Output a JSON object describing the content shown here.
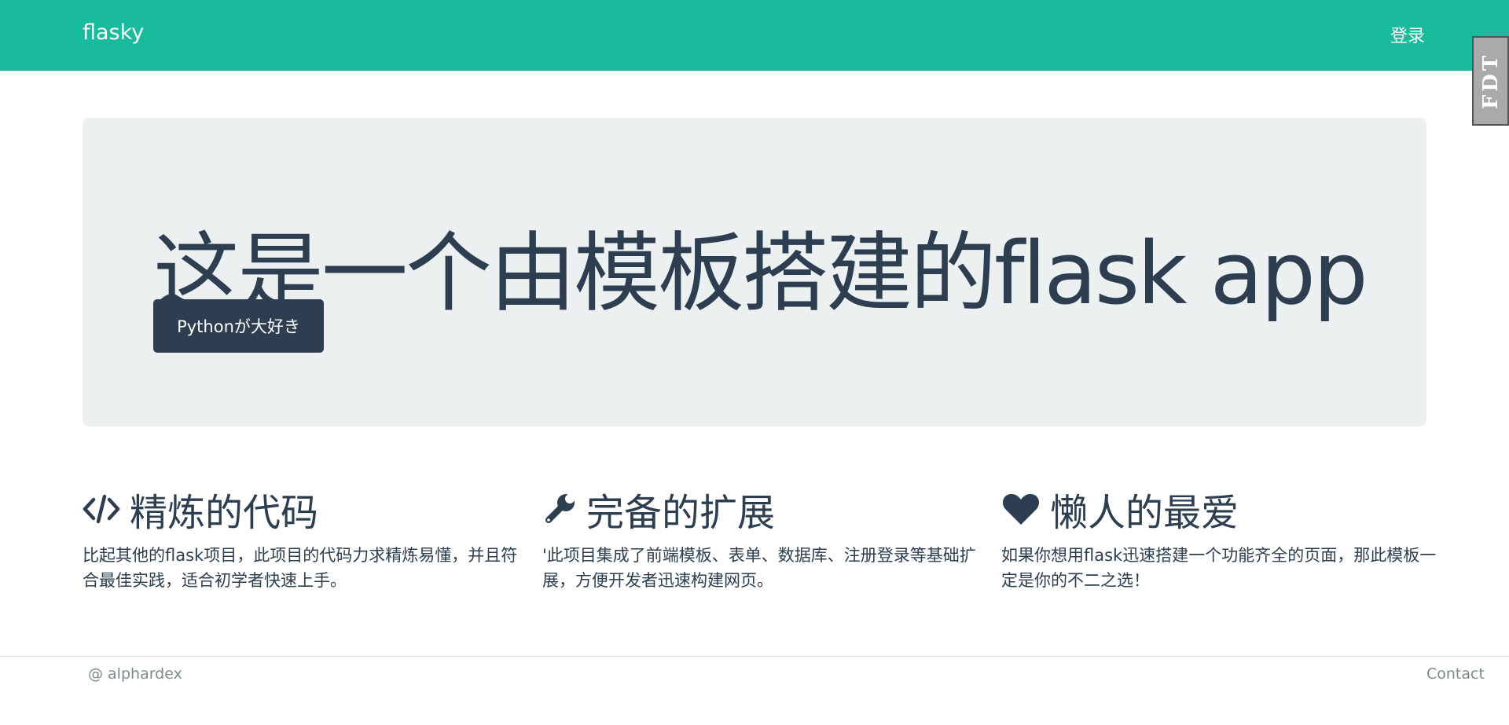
{
  "navbar": {
    "brand": "flasky",
    "login_label": "登录",
    "bg_color": "#18bc9c"
  },
  "fdt_badge": {
    "label": "FDT"
  },
  "jumbotron": {
    "title": "这是一个由模板搭建的flask app",
    "button_label": "Pythonが大好き"
  },
  "features": [
    {
      "icon": "code-icon",
      "title": "精炼的代码",
      "text": "比起其他的flask项目，此项目的代码力求精炼易懂，并且符合最佳实践，适合初学者快速上手。"
    },
    {
      "icon": "wrench-icon",
      "title": "完备的扩展",
      "text": "'此项目集成了前端模板、表单、数据库、注册登录等基础扩展，方便开发者迅速构建网页。"
    },
    {
      "icon": "heart-icon",
      "title": "懒人的最爱",
      "text": "如果你想用flask迅速搭建一个功能齐全的页面，那此模板一定是你的不二之选！"
    }
  ],
  "footer": {
    "copyright": "@ alphardex",
    "contact_label": "Contact"
  },
  "colors": {
    "primary": "#2c3e50",
    "accent": "#18bc9c",
    "jumbotron_bg": "#ecf0f1",
    "muted": "#7b8a8b"
  }
}
